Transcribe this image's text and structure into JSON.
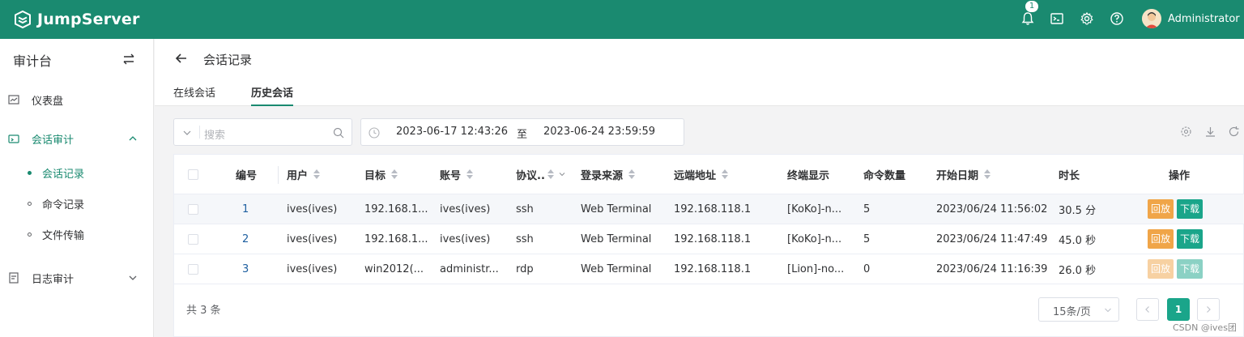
{
  "brand": {
    "name": "JumpServer",
    "color": "#1a8a70"
  },
  "topbar": {
    "notification_count": "1",
    "icons": [
      "bell-icon",
      "terminal-icon",
      "gear-icon",
      "help-icon"
    ],
    "user_name": "Administrator"
  },
  "sidebar": {
    "title": "审计台",
    "items": [
      {
        "label": "仪表盘",
        "icon": "dashboard-icon"
      },
      {
        "label": "会话审计",
        "icon": "session-audit-icon",
        "expanded": true,
        "children": [
          {
            "label": "会话记录",
            "active": true
          },
          {
            "label": "命令记录"
          },
          {
            "label": "文件传输"
          }
        ]
      },
      {
        "label": "日志审计",
        "icon": "log-audit-icon",
        "expanded": false
      }
    ]
  },
  "page": {
    "title": "会话记录",
    "tabs": [
      {
        "label": "在线会话",
        "active": false
      },
      {
        "label": "历史会话",
        "active": true
      }
    ]
  },
  "filters": {
    "search_placeholder": "搜索",
    "date_start": "2023-06-17 12:43:26",
    "date_separator": "至",
    "date_end": "2023-06-24 23:59:59"
  },
  "table": {
    "columns": [
      "编号",
      "用户",
      "目标",
      "账号",
      "协议..",
      "登录来源",
      "远端地址",
      "终端显示",
      "命令数量",
      "开始日期",
      "时长",
      "操作"
    ],
    "rows": [
      {
        "id": "1",
        "user": "ives(ives)",
        "target": "192.168.1...",
        "account": "ives(ives)",
        "protocol": "ssh",
        "source": "Web Terminal",
        "remote": "192.168.118.1",
        "terminal": "[KoKo]-n...",
        "commands": "5",
        "date": "2023/06/24 11:56:02",
        "duration": "30.5 分",
        "actions_enabled": true
      },
      {
        "id": "2",
        "user": "ives(ives)",
        "target": "192.168.1...",
        "account": "ives(ives)",
        "protocol": "ssh",
        "source": "Web Terminal",
        "remote": "192.168.118.1",
        "terminal": "[KoKo]-n...",
        "commands": "5",
        "date": "2023/06/24 11:47:49",
        "duration": "45.0 秒",
        "actions_enabled": true
      },
      {
        "id": "3",
        "user": "ives(ives)",
        "target": "win2012(...",
        "account": "administr...",
        "protocol": "rdp",
        "source": "Web Terminal",
        "remote": "192.168.118.1",
        "terminal": "[Lion]-no...",
        "commands": "0",
        "date": "2023/06/24 11:16:39",
        "duration": "26.0 秒",
        "actions_enabled": false
      }
    ],
    "action_play": "回放",
    "action_download": "下载"
  },
  "pagination": {
    "total": "共 3 条",
    "page_size": "15条/页",
    "current_page": "1"
  },
  "watermark": "CSDN @ives团"
}
